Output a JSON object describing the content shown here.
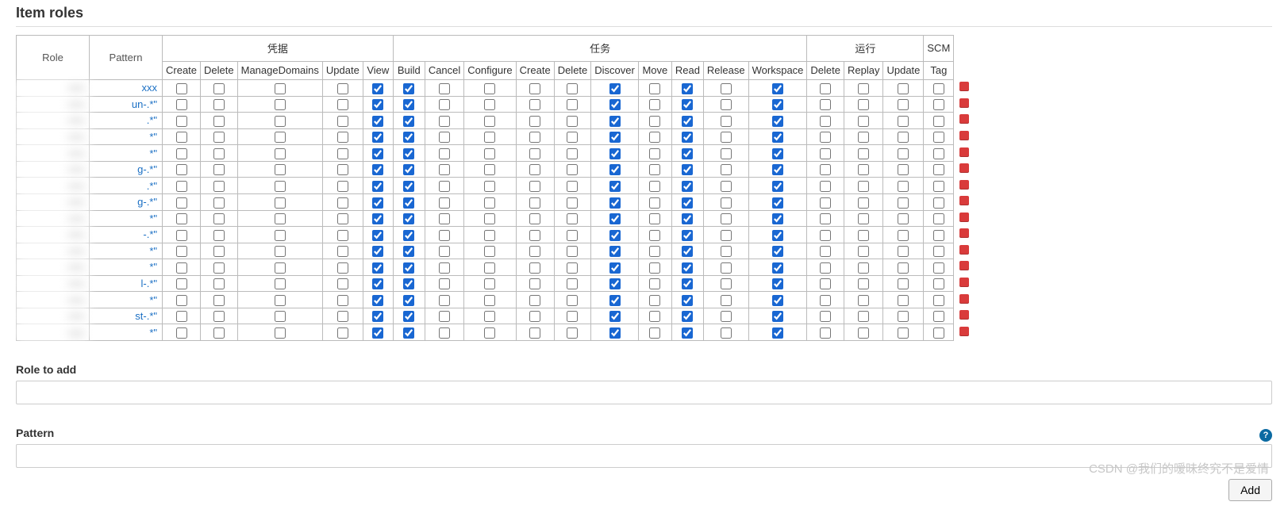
{
  "title": "Item roles",
  "headers": {
    "role": "Role",
    "pattern": "Pattern",
    "groups": {
      "cred": "凭据",
      "task": "任务",
      "run": "运行",
      "scm": "SCM"
    },
    "cols": {
      "cred_create": "Create",
      "cred_delete": "Delete",
      "cred_md": "ManageDomains",
      "cred_update": "Update",
      "cred_view": "View",
      "job_build": "Build",
      "job_cancel": "Cancel",
      "job_configure": "Configure",
      "job_create": "Create",
      "job_delete": "Delete",
      "job_discover": "Discover",
      "job_move": "Move",
      "job_read": "Read",
      "job_release": "Release",
      "job_workspace": "Workspace",
      "run_delete": "Delete",
      "run_replay": "Replay",
      "run_update": "Update",
      "scm_tag": "Tag"
    }
  },
  "rows": [
    {
      "role": "xxx",
      "pattern": "xxx",
      "checks": {
        "view": true,
        "build": true,
        "discover": true,
        "read": true,
        "workspace": true
      }
    },
    {
      "role": "xxx",
      "pattern": "un-.*\"",
      "checks": {
        "view": true,
        "build": true,
        "discover": true,
        "read": true,
        "workspace": true
      }
    },
    {
      "role": "xxx",
      "pattern": ".*\"",
      "checks": {
        "view": true,
        "build": true,
        "discover": true,
        "read": true,
        "workspace": true
      }
    },
    {
      "role": "xxx",
      "pattern": "*\"",
      "checks": {
        "view": true,
        "build": true,
        "discover": true,
        "read": true,
        "workspace": true
      }
    },
    {
      "role": "xxx",
      "pattern": "*\"",
      "checks": {
        "view": true,
        "build": true,
        "discover": true,
        "read": true,
        "workspace": true
      }
    },
    {
      "role": "xxx",
      "pattern": "g-.*\"",
      "checks": {
        "view": true,
        "build": true,
        "discover": true,
        "read": true,
        "workspace": true
      }
    },
    {
      "role": "xxx",
      "pattern": ".*\"",
      "checks": {
        "view": true,
        "build": true,
        "discover": true,
        "read": true,
        "workspace": true
      }
    },
    {
      "role": "xxx",
      "pattern": "g-.*\"",
      "checks": {
        "view": true,
        "build": true,
        "discover": true,
        "read": true,
        "workspace": true
      }
    },
    {
      "role": "xxx",
      "pattern": "*\"",
      "checks": {
        "view": true,
        "build": true,
        "discover": true,
        "read": true,
        "workspace": true
      }
    },
    {
      "role": "xxx",
      "pattern": "-.*\"",
      "checks": {
        "view": true,
        "build": true,
        "discover": true,
        "read": true,
        "workspace": true
      }
    },
    {
      "role": "xxx",
      "pattern": "*\"",
      "checks": {
        "view": true,
        "build": true,
        "discover": true,
        "read": true,
        "workspace": true
      }
    },
    {
      "role": "xxx",
      "pattern": "*\"",
      "checks": {
        "view": true,
        "build": true,
        "discover": true,
        "read": true,
        "workspace": true
      }
    },
    {
      "role": "xxx",
      "pattern": "l-.*\"",
      "checks": {
        "view": true,
        "build": true,
        "discover": true,
        "read": true,
        "workspace": true
      }
    },
    {
      "role": "xxx",
      "pattern": "*\"",
      "checks": {
        "view": true,
        "build": true,
        "discover": true,
        "read": true,
        "workspace": true
      }
    },
    {
      "role": "xxx",
      "pattern": "st-.*\"",
      "checks": {
        "view": true,
        "build": true,
        "discover": true,
        "read": true,
        "workspace": true
      }
    },
    {
      "role": "xxx",
      "pattern": "*\"",
      "checks": {
        "view": true,
        "build": true,
        "discover": true,
        "read": true,
        "workspace": true
      }
    }
  ],
  "form": {
    "role_label": "Role to add",
    "pattern_label": "Pattern",
    "add_button": "Add"
  },
  "watermark": "CSDN @我们的暧昧终究不是爱情"
}
